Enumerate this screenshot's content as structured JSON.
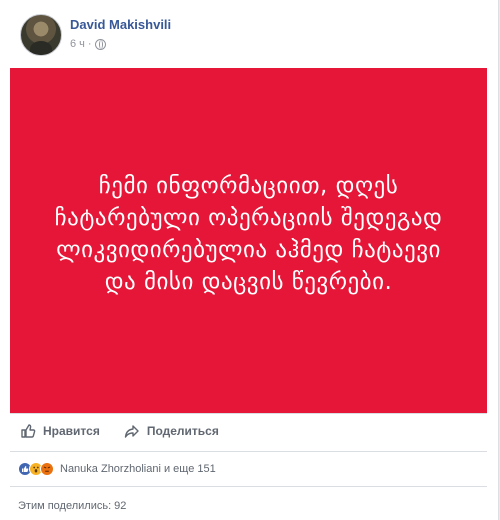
{
  "post": {
    "author": "David Makishvili",
    "time": "6 ч",
    "separator": "·",
    "banner_text": "ჩემი ინფორმაციით, დღეს ჩატარებული ოპერაციის შედეგად ლიკვიდირებულია აჰმედ ჩატაევი და მისი დაცვის წევრები.",
    "banner_color": "#e51638"
  },
  "actions": {
    "like_label": "Нравится",
    "share_label": "Поделиться"
  },
  "reactions": {
    "icons": [
      "like-icon",
      "wow-icon",
      "angry-icon"
    ],
    "summary": "Nanuka Zhorzholiani и еще 151"
  },
  "shares": {
    "label": "Этим поделились: 92"
  }
}
